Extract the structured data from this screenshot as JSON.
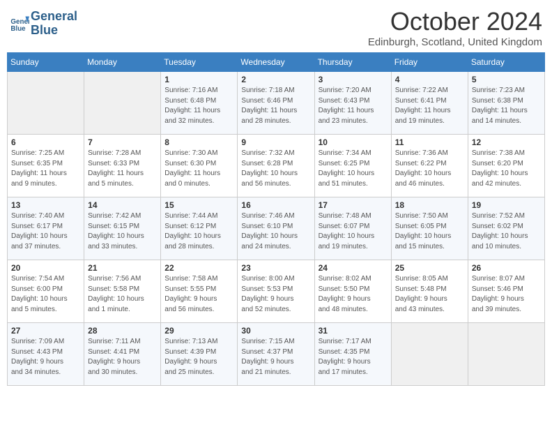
{
  "header": {
    "logo_line1": "General",
    "logo_line2": "Blue",
    "month": "October 2024",
    "location": "Edinburgh, Scotland, United Kingdom"
  },
  "weekdays": [
    "Sunday",
    "Monday",
    "Tuesday",
    "Wednesday",
    "Thursday",
    "Friday",
    "Saturday"
  ],
  "weeks": [
    [
      {
        "day": "",
        "info": ""
      },
      {
        "day": "",
        "info": ""
      },
      {
        "day": "1",
        "info": "Sunrise: 7:16 AM\nSunset: 6:48 PM\nDaylight: 11 hours\nand 32 minutes."
      },
      {
        "day": "2",
        "info": "Sunrise: 7:18 AM\nSunset: 6:46 PM\nDaylight: 11 hours\nand 28 minutes."
      },
      {
        "day": "3",
        "info": "Sunrise: 7:20 AM\nSunset: 6:43 PM\nDaylight: 11 hours\nand 23 minutes."
      },
      {
        "day": "4",
        "info": "Sunrise: 7:22 AM\nSunset: 6:41 PM\nDaylight: 11 hours\nand 19 minutes."
      },
      {
        "day": "5",
        "info": "Sunrise: 7:23 AM\nSunset: 6:38 PM\nDaylight: 11 hours\nand 14 minutes."
      }
    ],
    [
      {
        "day": "6",
        "info": "Sunrise: 7:25 AM\nSunset: 6:35 PM\nDaylight: 11 hours\nand 9 minutes."
      },
      {
        "day": "7",
        "info": "Sunrise: 7:28 AM\nSunset: 6:33 PM\nDaylight: 11 hours\nand 5 minutes."
      },
      {
        "day": "8",
        "info": "Sunrise: 7:30 AM\nSunset: 6:30 PM\nDaylight: 11 hours\nand 0 minutes."
      },
      {
        "day": "9",
        "info": "Sunrise: 7:32 AM\nSunset: 6:28 PM\nDaylight: 10 hours\nand 56 minutes."
      },
      {
        "day": "10",
        "info": "Sunrise: 7:34 AM\nSunset: 6:25 PM\nDaylight: 10 hours\nand 51 minutes."
      },
      {
        "day": "11",
        "info": "Sunrise: 7:36 AM\nSunset: 6:22 PM\nDaylight: 10 hours\nand 46 minutes."
      },
      {
        "day": "12",
        "info": "Sunrise: 7:38 AM\nSunset: 6:20 PM\nDaylight: 10 hours\nand 42 minutes."
      }
    ],
    [
      {
        "day": "13",
        "info": "Sunrise: 7:40 AM\nSunset: 6:17 PM\nDaylight: 10 hours\nand 37 minutes."
      },
      {
        "day": "14",
        "info": "Sunrise: 7:42 AM\nSunset: 6:15 PM\nDaylight: 10 hours\nand 33 minutes."
      },
      {
        "day": "15",
        "info": "Sunrise: 7:44 AM\nSunset: 6:12 PM\nDaylight: 10 hours\nand 28 minutes."
      },
      {
        "day": "16",
        "info": "Sunrise: 7:46 AM\nSunset: 6:10 PM\nDaylight: 10 hours\nand 24 minutes."
      },
      {
        "day": "17",
        "info": "Sunrise: 7:48 AM\nSunset: 6:07 PM\nDaylight: 10 hours\nand 19 minutes."
      },
      {
        "day": "18",
        "info": "Sunrise: 7:50 AM\nSunset: 6:05 PM\nDaylight: 10 hours\nand 15 minutes."
      },
      {
        "day": "19",
        "info": "Sunrise: 7:52 AM\nSunset: 6:02 PM\nDaylight: 10 hours\nand 10 minutes."
      }
    ],
    [
      {
        "day": "20",
        "info": "Sunrise: 7:54 AM\nSunset: 6:00 PM\nDaylight: 10 hours\nand 5 minutes."
      },
      {
        "day": "21",
        "info": "Sunrise: 7:56 AM\nSunset: 5:58 PM\nDaylight: 10 hours\nand 1 minute."
      },
      {
        "day": "22",
        "info": "Sunrise: 7:58 AM\nSunset: 5:55 PM\nDaylight: 9 hours\nand 56 minutes."
      },
      {
        "day": "23",
        "info": "Sunrise: 8:00 AM\nSunset: 5:53 PM\nDaylight: 9 hours\nand 52 minutes."
      },
      {
        "day": "24",
        "info": "Sunrise: 8:02 AM\nSunset: 5:50 PM\nDaylight: 9 hours\nand 48 minutes."
      },
      {
        "day": "25",
        "info": "Sunrise: 8:05 AM\nSunset: 5:48 PM\nDaylight: 9 hours\nand 43 minutes."
      },
      {
        "day": "26",
        "info": "Sunrise: 8:07 AM\nSunset: 5:46 PM\nDaylight: 9 hours\nand 39 minutes."
      }
    ],
    [
      {
        "day": "27",
        "info": "Sunrise: 7:09 AM\nSunset: 4:43 PM\nDaylight: 9 hours\nand 34 minutes."
      },
      {
        "day": "28",
        "info": "Sunrise: 7:11 AM\nSunset: 4:41 PM\nDaylight: 9 hours\nand 30 minutes."
      },
      {
        "day": "29",
        "info": "Sunrise: 7:13 AM\nSunset: 4:39 PM\nDaylight: 9 hours\nand 25 minutes."
      },
      {
        "day": "30",
        "info": "Sunrise: 7:15 AM\nSunset: 4:37 PM\nDaylight: 9 hours\nand 21 minutes."
      },
      {
        "day": "31",
        "info": "Sunrise: 7:17 AM\nSunset: 4:35 PM\nDaylight: 9 hours\nand 17 minutes."
      },
      {
        "day": "",
        "info": ""
      },
      {
        "day": "",
        "info": ""
      }
    ]
  ]
}
